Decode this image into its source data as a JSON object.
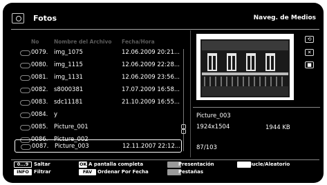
{
  "header": {
    "title": "Fotos",
    "nav_label": "Naveg. de Medios"
  },
  "columns": {
    "no": "No",
    "name": "Nombre del Archivo",
    "date": "Fecha/Hora"
  },
  "files": [
    {
      "num": "0079.",
      "name": "img_1075",
      "date": "12.06.2009 20:21..."
    },
    {
      "num": "0080.",
      "name": "img_1115",
      "date": "12.06.2009 22:28..."
    },
    {
      "num": "0081.",
      "name": "img_1131",
      "date": "12.06.2009 23:56..."
    },
    {
      "num": "0082.",
      "name": "s8000381",
      "date": "17.07.2009 16:58..."
    },
    {
      "num": "0083.",
      "name": "sdc11181",
      "date": "21.10.2009 16:55..."
    },
    {
      "num": "0084.",
      "name": "y",
      "date": ""
    },
    {
      "num": "0085.",
      "name": "Picture_001",
      "date": ""
    },
    {
      "num": "0086.",
      "name": "Picture_002",
      "date": ""
    },
    {
      "num": "0087.",
      "name": "Picture_003",
      "date": "12.11.2007 22:12..."
    }
  ],
  "selected": {
    "name": "Picture_003",
    "resolution": "1924x1504",
    "size": "1944 KB",
    "position": "87/103"
  },
  "legend": {
    "jump_key": "0...9",
    "jump_label": "Saltar",
    "info_key": "INFO",
    "filter_label": "Filtrar",
    "ok_key": "OK",
    "fullscreen_label": "A pantalla completa",
    "fav_key": "FAV",
    "sort_label": "Ordenar Por Fecha",
    "slideshow_label": "Presentación",
    "loop_label": "Bucle/Aleatorio",
    "tabs_label": "Pestañas"
  },
  "icons": {
    "app": "photo-folder-icon",
    "file": "file-icon",
    "loop": "loop-icon",
    "shuffle": "shuffle-icon",
    "stop": "stop-icon"
  },
  "colors": {
    "background": "#000000",
    "text": "#ffffff",
    "column_header": "#5a5a5a"
  }
}
